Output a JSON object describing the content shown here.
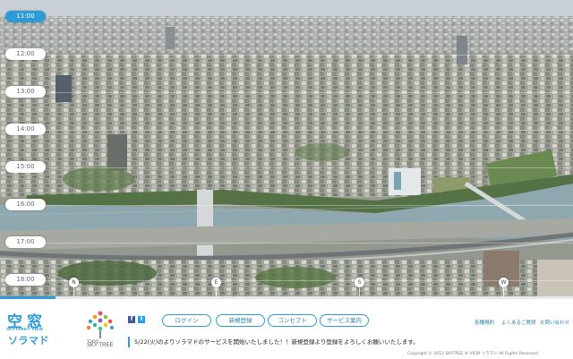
{
  "times": [
    "11:00",
    "12:00",
    "13:00",
    "14:00",
    "15:00",
    "16:00",
    "17:00",
    "18:00"
  ],
  "active_time": "11:00",
  "compass": [
    "N",
    "E",
    "S",
    "W"
  ],
  "logo": {
    "kanji": "空窓",
    "sub": "SKYTREE® VIEW",
    "kana": "ソラマド"
  },
  "tree_logo": {
    "small": "TOKYO",
    "label": "SKY TREE"
  },
  "social": {
    "facebook": "f",
    "twitter": "t"
  },
  "nav": {
    "login": "ログイン",
    "register": "新規登録",
    "concept": "コンセプト",
    "service": "サービス案内"
  },
  "links": {
    "terms": "各種規約",
    "faq": "よくあるご質問",
    "contact": "お問い合わせ"
  },
  "notice": "5/22(火)のよりソラマドのサービスを開始いたしました！！新規登録より登録をよろしくお願いいたします。",
  "copyright": "Copyright © 2012 SKYTREE ® VIEW ソラマド All Rights Reserved.",
  "colors": {
    "accent": "#2d9bd6",
    "river": "#8fa8b0"
  }
}
